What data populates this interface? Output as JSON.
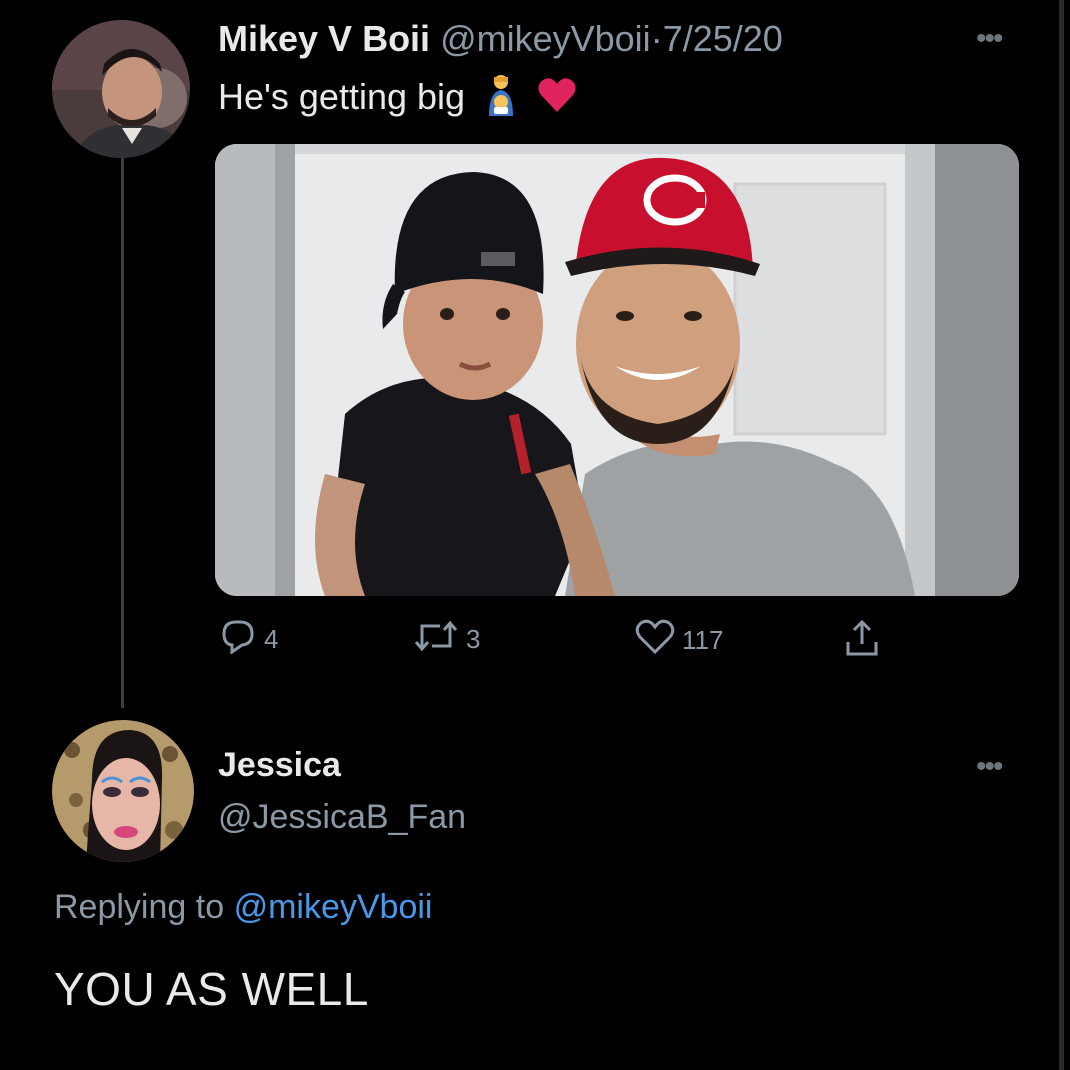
{
  "tweet": {
    "author_name": "Mikey V Boii",
    "author_handle": "@mikeyVboii",
    "separator": "·",
    "date": "7/25/20",
    "text": "He's getting big",
    "emojis": [
      "person-feeding-baby-emoji",
      "red-heart-emoji"
    ],
    "stats": {
      "replies": "4",
      "retweets": "3",
      "likes": "117"
    }
  },
  "reply": {
    "author_name": "Jessica",
    "author_handle": "@JessicaB_Fan",
    "replying_to_prefix": "Replying to",
    "replying_to_handle": "@mikeyVboii",
    "text": "YOU AS WELL"
  },
  "icons": {
    "more": "more-horizontal-icon",
    "reply": "reply-icon",
    "retweet": "retweet-icon",
    "like": "heart-icon",
    "share": "share-icon"
  },
  "colors": {
    "background": "#000000",
    "primary_text": "#e7e9ea",
    "secondary_text": "#8b98a5",
    "mention": "#4a99e9",
    "heart_emoji": "#e0245e",
    "cap_red": "#c8102e"
  }
}
